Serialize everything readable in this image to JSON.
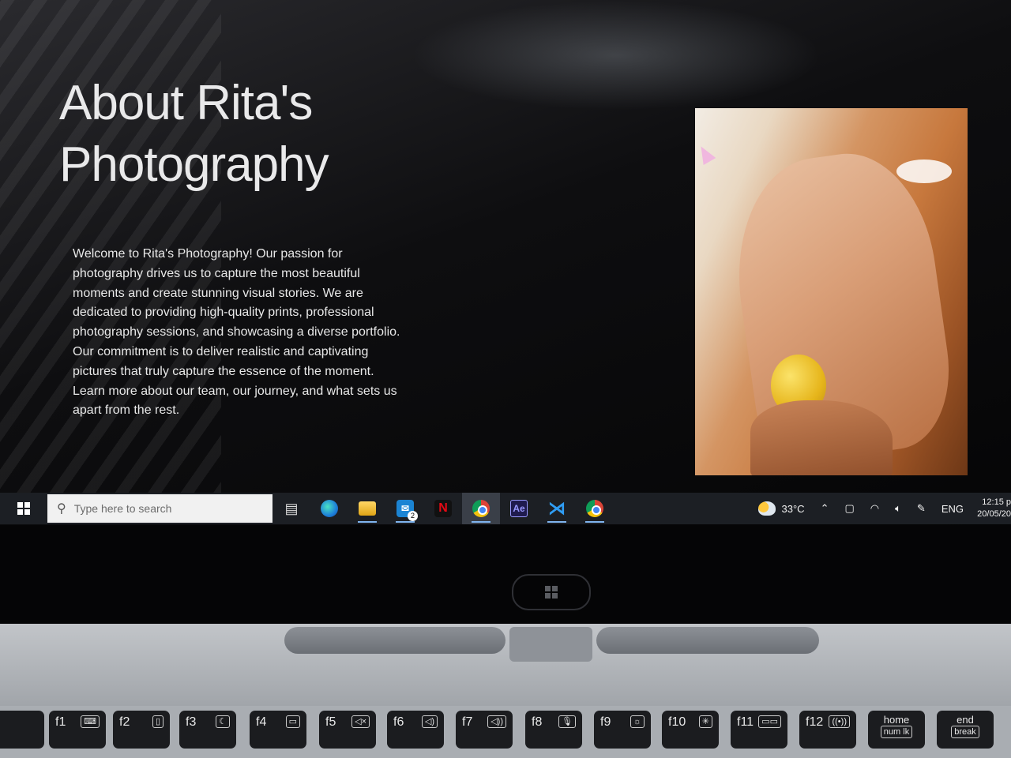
{
  "page": {
    "title": "About Rita's Photography",
    "intro": "Welcome to Rita's Photography! Our passion for photography drives us to capture the most beautiful moments and create stunning visual stories. We are dedicated to providing high-quality prints, professional photography sessions, and showcasing a diverse portfolio. Our commitment is to deliver realistic and captivating pictures that truly capture the essence of the moment. Learn more about our team, our journey, and what sets us apart from the rest."
  },
  "taskbar": {
    "search_placeholder": "Type here to search",
    "mail_badge": "2",
    "netflix_label": "N",
    "ae_label": "Ae",
    "weather": "33°C",
    "language": "ENG",
    "time": "12:15 p",
    "date": "20/05/20",
    "pinned_apps": [
      "task-view",
      "edge",
      "file-explorer",
      "mail",
      "netflix",
      "chrome",
      "after-effects",
      "vscode",
      "chrome"
    ]
  },
  "keyboard": {
    "keys": [
      "f1",
      "f2",
      "f3",
      "f4",
      "f5",
      "f6",
      "f7",
      "f8",
      "f9",
      "f10",
      "f11",
      "f12"
    ],
    "home": "home",
    "num_lk": "num lk",
    "end": "end",
    "break": "break"
  },
  "colors": {
    "accent": "#7fb4ee",
    "taskbar": "#1c1f24",
    "page_bg": "#0e0e10"
  }
}
